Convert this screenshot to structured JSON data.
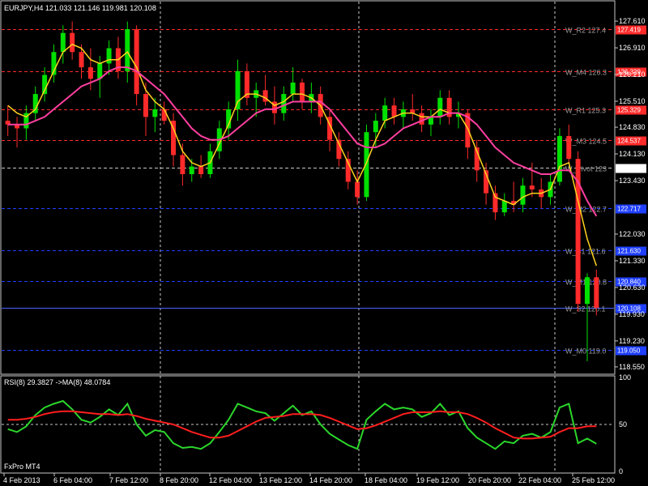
{
  "header": {
    "symbol_line": "EURJPY,H4  121.033 121.146 119.981 120.108"
  },
  "footer": {
    "broker": "FxPro MT4"
  },
  "colors": {
    "background": "#000000",
    "bull": "#00e000",
    "bear": "#ff2a2a",
    "ma_fast": "#ffd21e",
    "ma_slow": "#ff3fa0",
    "resistance": "#ff2a2a",
    "support": "#1f3fff",
    "current_line": "#4a62ff",
    "rsi": "#2bd62b",
    "rsi_ma": "#ff1e1e",
    "grid": "#c8c8c8"
  },
  "chart_data": [
    {
      "type": "candlestick",
      "title": "EURJPY,H4",
      "ohlc_header": {
        "open": 121.033,
        "high": 121.146,
        "low": 119.981,
        "close": 120.108
      },
      "ylim": [
        118.4,
        128.1
      ],
      "y_ticks": [
        "127.610",
        "126.910",
        "126.210",
        "125.510",
        "124.830",
        "124.130",
        "123.430",
        "122.030",
        "121.330",
        "120.630",
        "119.930",
        "119.230",
        "118.550"
      ],
      "x_ticks": [
        "4 Feb 2013",
        "6 Feb 04:00",
        "7 Feb 12:00",
        "8 Feb 20:00",
        "12 Feb 04:00",
        "13 Feb 12:00",
        "14 Feb 20:00",
        "18 Feb 04:00",
        "19 Feb 12:00",
        "20 Feb 20:00",
        "22 Feb 04:00",
        "25 Feb 12:00"
      ],
      "current_price": 123.772,
      "candles": [
        [
          125.0,
          125.4,
          124.6,
          124.9
        ],
        [
          124.9,
          125.1,
          124.3,
          124.8
        ],
        [
          124.8,
          125.4,
          124.5,
          125.2
        ],
        [
          125.2,
          125.9,
          125.0,
          125.7
        ],
        [
          125.7,
          126.4,
          125.5,
          126.2
        ],
        [
          126.2,
          127.0,
          126.0,
          126.8
        ],
        [
          126.8,
          127.5,
          126.5,
          127.3
        ],
        [
          127.3,
          127.6,
          126.6,
          126.8
        ],
        [
          126.8,
          127.0,
          126.1,
          126.4
        ],
        [
          126.4,
          126.9,
          125.8,
          126.1
        ],
        [
          126.1,
          126.7,
          125.6,
          126.5
        ],
        [
          126.5,
          127.1,
          126.2,
          126.9
        ],
        [
          126.9,
          127.2,
          126.1,
          126.3
        ],
        [
          126.3,
          127.6,
          126.0,
          127.4
        ],
        [
          127.4,
          127.5,
          125.4,
          125.7
        ],
        [
          125.7,
          126.0,
          124.6,
          125.1
        ],
        [
          125.1,
          125.6,
          124.7,
          125.3
        ],
        [
          125.3,
          125.5,
          124.9,
          125.0
        ],
        [
          125.0,
          125.2,
          123.8,
          124.1
        ],
        [
          124.1,
          124.4,
          123.3,
          123.6
        ],
        [
          123.6,
          124.0,
          123.4,
          123.8
        ],
        [
          123.8,
          124.1,
          123.5,
          123.6
        ],
        [
          123.6,
          124.4,
          123.5,
          124.2
        ],
        [
          124.2,
          125.0,
          124.0,
          124.8
        ],
        [
          124.8,
          125.5,
          124.5,
          125.3
        ],
        [
          125.3,
          126.6,
          125.0,
          126.3
        ],
        [
          126.3,
          126.5,
          125.4,
          125.6
        ],
        [
          125.6,
          126.0,
          125.1,
          125.8
        ],
        [
          125.8,
          126.2,
          125.4,
          125.5
        ],
        [
          125.5,
          125.9,
          124.9,
          125.2
        ],
        [
          125.2,
          125.9,
          125.0,
          125.7
        ],
        [
          125.7,
          126.4,
          125.5,
          126.0
        ],
        [
          126.0,
          126.1,
          125.3,
          125.5
        ],
        [
          125.5,
          126.0,
          125.2,
          125.7
        ],
        [
          125.7,
          125.9,
          124.9,
          125.1
        ],
        [
          125.1,
          125.3,
          124.2,
          124.5
        ],
        [
          124.5,
          124.7,
          123.8,
          124.0
        ],
        [
          124.0,
          124.2,
          123.2,
          123.4
        ],
        [
          123.4,
          123.7,
          122.8,
          123.0
        ],
        [
          123.0,
          124.9,
          122.9,
          124.7
        ],
        [
          124.7,
          125.2,
          124.3,
          125.0
        ],
        [
          125.0,
          125.6,
          124.8,
          125.4
        ],
        [
          125.4,
          125.6,
          124.9,
          125.1
        ],
        [
          125.1,
          125.5,
          124.8,
          125.3
        ],
        [
          125.3,
          125.7,
          125.0,
          125.2
        ],
        [
          125.2,
          125.4,
          124.7,
          124.9
        ],
        [
          124.9,
          125.3,
          124.6,
          125.1
        ],
        [
          125.1,
          125.8,
          124.9,
          125.6
        ],
        [
          125.6,
          125.8,
          124.9,
          125.1
        ],
        [
          125.1,
          125.5,
          124.8,
          125.2
        ],
        [
          125.2,
          125.3,
          124.0,
          124.3
        ],
        [
          124.3,
          124.5,
          123.4,
          123.7
        ],
        [
          123.7,
          123.9,
          122.8,
          123.1
        ],
        [
          123.1,
          123.3,
          122.4,
          122.6
        ],
        [
          122.6,
          123.1,
          122.5,
          122.9
        ],
        [
          122.9,
          123.4,
          122.6,
          122.8
        ],
        [
          122.8,
          123.5,
          122.6,
          123.3
        ],
        [
          123.3,
          123.9,
          123.0,
          123.2
        ],
        [
          123.2,
          123.5,
          122.7,
          123.0
        ],
        [
          123.0,
          123.6,
          122.8,
          123.4
        ],
        [
          123.4,
          124.8,
          123.3,
          124.6
        ],
        [
          124.6,
          124.9,
          123.9,
          124.0
        ],
        [
          124.0,
          124.2,
          120.0,
          120.2
        ],
        [
          120.2,
          121.0,
          118.7,
          120.9
        ],
        [
          120.9,
          121.1,
          119.9,
          120.1
        ]
      ],
      "series": [
        {
          "values": [
            125.4,
            125.2,
            125.1,
            125.3,
            125.8,
            126.3,
            126.8,
            127.0,
            126.9,
            126.6,
            126.5,
            126.6,
            126.6,
            126.8,
            126.4,
            125.8,
            125.5,
            125.3,
            124.8,
            124.2,
            123.9,
            123.8,
            123.9,
            124.4,
            124.9,
            125.5,
            125.7,
            125.7,
            125.6,
            125.4,
            125.5,
            125.7,
            125.7,
            125.6,
            125.4,
            124.9,
            124.4,
            123.9,
            123.4,
            123.9,
            124.5,
            125.0,
            125.1,
            125.2,
            125.2,
            125.1,
            125.1,
            125.3,
            125.2,
            125.2,
            124.8,
            124.2,
            123.6,
            123.0,
            122.9,
            122.8,
            123.0,
            123.1,
            123.1,
            123.2,
            123.8,
            123.9,
            122.9,
            121.9,
            121.2
          ]
        },
        {
          "values": [
            124.9,
            124.9,
            124.9,
            125.0,
            125.1,
            125.3,
            125.5,
            125.7,
            125.9,
            126.0,
            126.1,
            126.3,
            126.4,
            126.4,
            126.3,
            126.1,
            125.9,
            125.7,
            125.4,
            125.1,
            124.8,
            124.6,
            124.5,
            124.5,
            124.6,
            124.8,
            125.0,
            125.2,
            125.3,
            125.3,
            125.4,
            125.5,
            125.5,
            125.5,
            125.5,
            125.3,
            125.0,
            124.7,
            124.4,
            124.3,
            124.3,
            124.4,
            124.6,
            124.8,
            124.9,
            125.0,
            125.1,
            125.1,
            125.2,
            125.2,
            125.1,
            124.9,
            124.6,
            124.3,
            124.1,
            123.9,
            123.8,
            123.7,
            123.6,
            123.6,
            123.7,
            123.7,
            123.4,
            122.9,
            122.5
          ]
        }
      ],
      "levels": [
        {
          "name": "W_R2 127.4",
          "price": 127.4,
          "box": "127.419",
          "kind": "resistance"
        },
        {
          "name": "W_M4 126.3",
          "price": 126.3,
          "box": "126.329",
          "kind": "resistance"
        },
        {
          "name": "W_R1 125.3",
          "price": 125.3,
          "box": "125.329",
          "kind": "resistance"
        },
        {
          "name": "W_M3 124.5",
          "price": 124.5,
          "box": "124.537",
          "kind": "resistance"
        },
        {
          "name": "W_Pivot 123",
          "price": 123.772,
          "box": "123.772",
          "kind": "current"
        },
        {
          "name": "W_M2 122.7",
          "price": 122.7,
          "box": "122.717",
          "kind": "support"
        },
        {
          "name": "W_S1 121.6",
          "price": 121.6,
          "box": "121.630",
          "kind": "support"
        },
        {
          "name": "W_M1 120.8",
          "price": 120.8,
          "box": "120.840",
          "kind": "support"
        },
        {
          "name": "W_S2 120.1",
          "price": 120.1,
          "box": "120.108",
          "kind": "support_current"
        },
        {
          "name": "W_M0 119.0",
          "price": 119.0,
          "box": "119.050",
          "kind": "support"
        }
      ]
    },
    {
      "type": "line",
      "title": "RSI(8) 29.3827  ->MA(8) 48.0784",
      "ylim": [
        0,
        100
      ],
      "y_ticks": [
        "100",
        "50",
        "0"
      ],
      "series": [
        {
          "values": [
            45,
            42,
            48,
            60,
            68,
            72,
            75,
            66,
            55,
            52,
            58,
            66,
            60,
            72,
            50,
            38,
            44,
            42,
            30,
            25,
            26,
            24,
            30,
            42,
            55,
            72,
            68,
            64,
            62,
            54,
            62,
            70,
            60,
            64,
            50,
            40,
            34,
            28,
            24,
            55,
            64,
            72,
            66,
            68,
            66,
            58,
            62,
            72,
            60,
            64,
            46,
            36,
            30,
            24,
            32,
            30,
            38,
            40,
            36,
            42,
            68,
            72,
            30,
            35,
            29.4
          ]
        },
        {
          "values": [
            55,
            55,
            56,
            58,
            61,
            63,
            64,
            64,
            63,
            62,
            61,
            61,
            60,
            61,
            59,
            56,
            54,
            52,
            50,
            46,
            42,
            39,
            36,
            36,
            38,
            43,
            48,
            53,
            57,
            58,
            59,
            61,
            61,
            61,
            60,
            57,
            53,
            49,
            45,
            46,
            49,
            53,
            57,
            61,
            63,
            63,
            63,
            64,
            63,
            63,
            61,
            57,
            52,
            46,
            41,
            36,
            35,
            35,
            36,
            37,
            42,
            46,
            46,
            48,
            48.1
          ]
        }
      ]
    }
  ]
}
